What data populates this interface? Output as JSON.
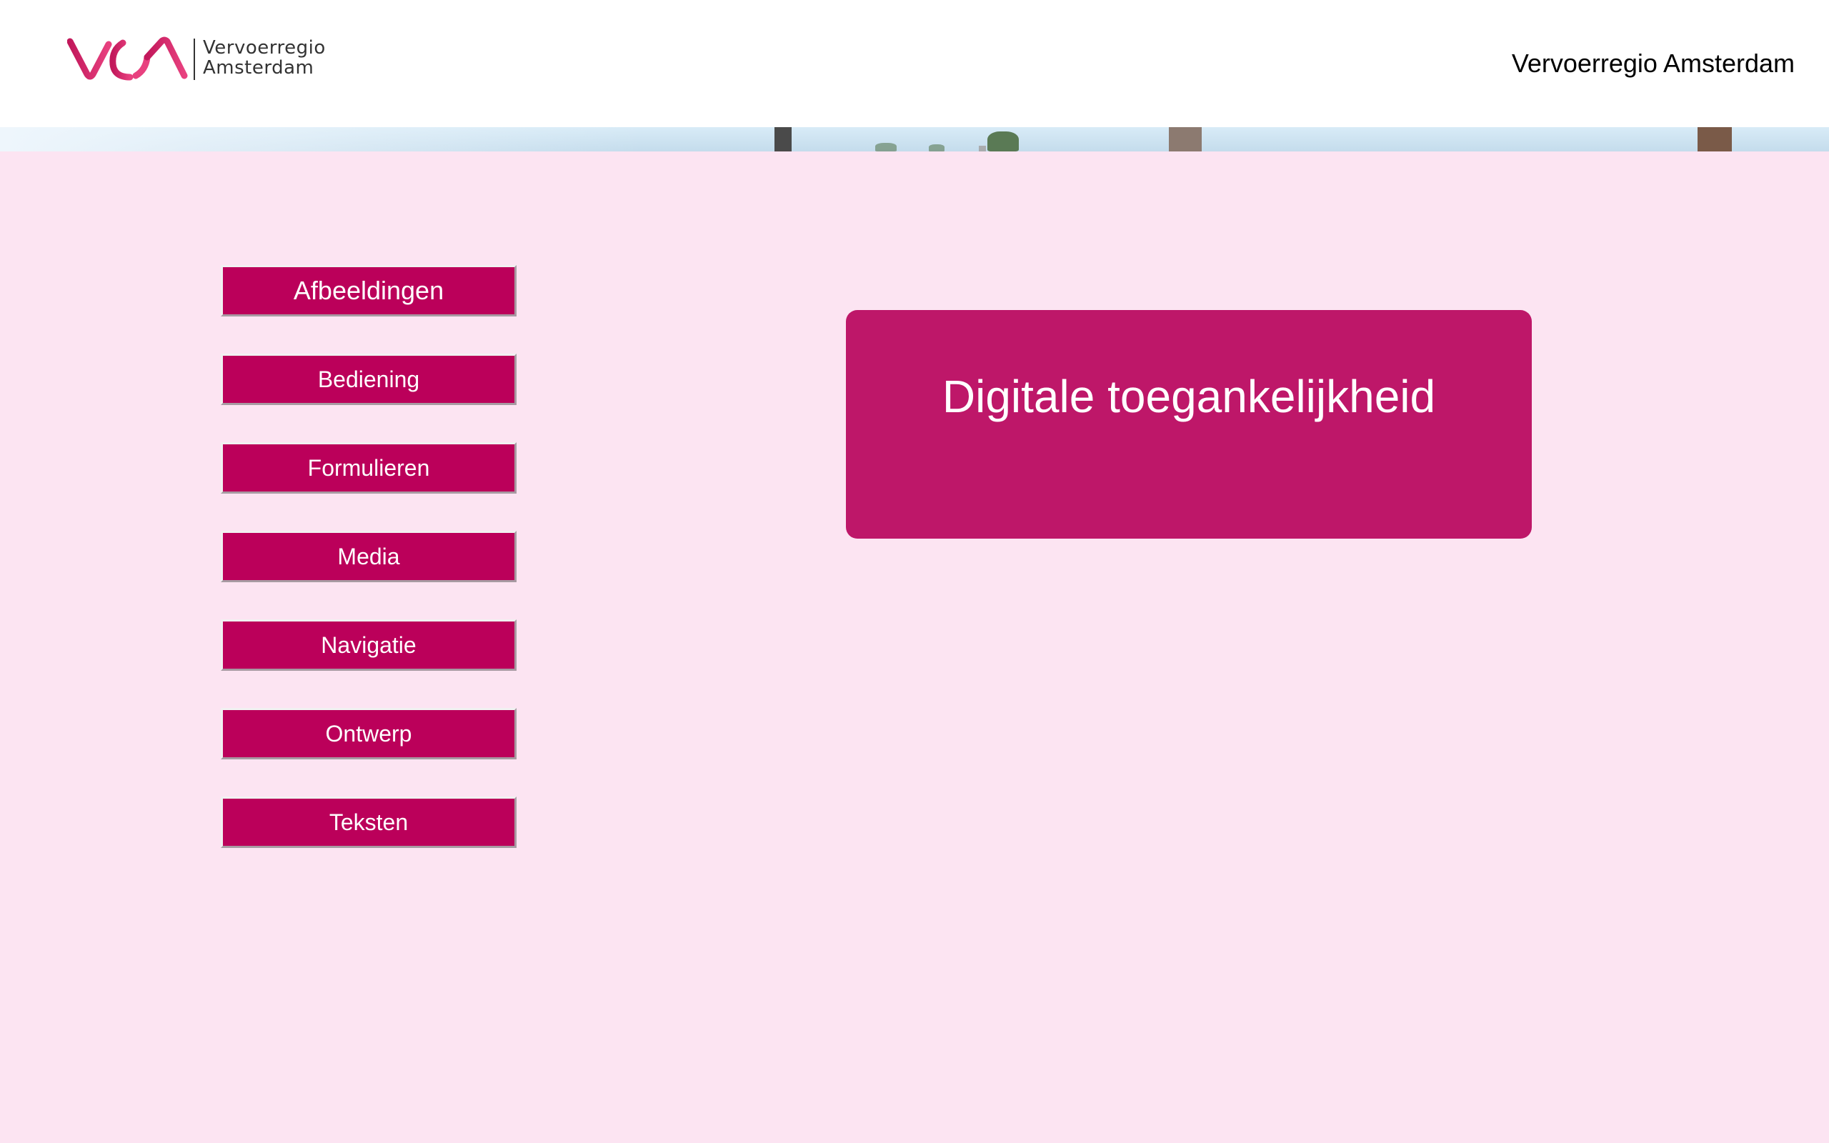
{
  "header": {
    "logo_line1": "Vervoerregio",
    "logo_line2": "Amsterdam",
    "title": "Vervoerregio Amsterdam"
  },
  "nav": {
    "items": [
      {
        "label": "Afbeeldingen"
      },
      {
        "label": "Bediening"
      },
      {
        "label": "Formulieren"
      },
      {
        "label": "Media"
      },
      {
        "label": "Navigatie"
      },
      {
        "label": "Ontwerp"
      },
      {
        "label": "Teksten"
      }
    ]
  },
  "main": {
    "panel_title": "Digitale toegankelijkheid"
  },
  "colors": {
    "brand": "#bb005a",
    "panel": "#be1769",
    "background": "#fce4f2",
    "logo_gradient_start": "#c2185b",
    "logo_gradient_end": "#e8417f"
  }
}
